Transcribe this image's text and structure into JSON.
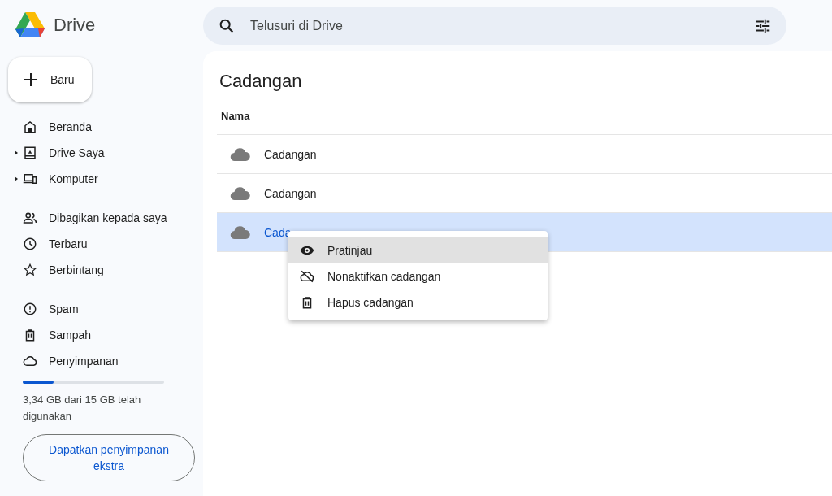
{
  "app": {
    "name": "Drive"
  },
  "new_button": {
    "label": "Baru"
  },
  "search": {
    "placeholder": "Telusuri di Drive"
  },
  "sidebar": {
    "groups": [
      [
        {
          "label": "Beranda",
          "expandable": false
        },
        {
          "label": "Drive Saya",
          "expandable": true
        },
        {
          "label": "Komputer",
          "expandable": true
        }
      ],
      [
        {
          "label": "Dibagikan kepada saya",
          "expandable": false
        },
        {
          "label": "Terbaru",
          "expandable": false
        },
        {
          "label": "Berbintang",
          "expandable": false
        }
      ],
      [
        {
          "label": "Spam",
          "expandable": false
        },
        {
          "label": "Sampah",
          "expandable": false
        },
        {
          "label": "Penyimpanan",
          "expandable": false
        }
      ]
    ]
  },
  "storage": {
    "level": 0.22,
    "text": "3,34 GB dari 15 GB telah digunakan",
    "button": "Dapatkan penyimpanan ekstra"
  },
  "page": {
    "title": "Cadangan"
  },
  "table": {
    "columns": [
      "Nama"
    ],
    "rows": [
      {
        "name": "Cadangan",
        "selected": false
      },
      {
        "name": "Cadangan",
        "selected": false
      },
      {
        "name": "Cada",
        "selected": true
      }
    ]
  },
  "context_menu": {
    "items": [
      {
        "label": "Pratinjau",
        "selected": true
      },
      {
        "label": "Nonaktifkan cadangan",
        "selected": false
      },
      {
        "label": "Hapus cadangan",
        "selected": false
      }
    ]
  }
}
